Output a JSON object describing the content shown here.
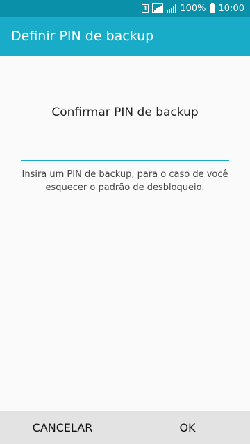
{
  "status_bar": {
    "sim_label": "1",
    "battery": "100%",
    "time": "10:00"
  },
  "app_bar": {
    "title": "Definir PIN de backup"
  },
  "main": {
    "prompt": "Confirmar PIN de backup",
    "pin_value": "",
    "hint_line1": "Insira um PIN de backup, para o caso de você",
    "hint_line2": "esquecer o padrão de desbloqueio."
  },
  "buttons": {
    "cancel": "CANCELAR",
    "ok": "OK"
  },
  "colors": {
    "status_bar": "#0b90a9",
    "app_bar": "#19acc8",
    "accent": "#19acc8",
    "button_bar": "#e3e3e3"
  }
}
